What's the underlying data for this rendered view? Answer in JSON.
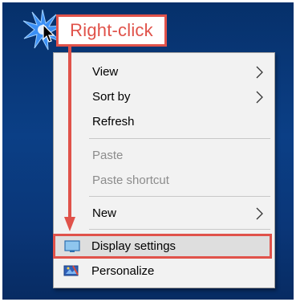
{
  "annotation": {
    "callout_text": "Right-click",
    "accent_color": "#e0524a"
  },
  "context_menu": {
    "items": [
      {
        "label": "View",
        "has_submenu": true,
        "disabled": false
      },
      {
        "label": "Sort by",
        "has_submenu": true,
        "disabled": false
      },
      {
        "label": "Refresh",
        "has_submenu": false,
        "disabled": false
      },
      {
        "label": "Paste",
        "has_submenu": false,
        "disabled": true
      },
      {
        "label": "Paste shortcut",
        "has_submenu": false,
        "disabled": true
      },
      {
        "label": "New",
        "has_submenu": true,
        "disabled": false
      },
      {
        "label": "Display settings",
        "has_submenu": false,
        "disabled": false,
        "icon": "display-icon",
        "highlighted": true
      },
      {
        "label": "Personalize",
        "has_submenu": false,
        "disabled": false,
        "icon": "personalize-icon"
      }
    ]
  },
  "desktop": {
    "background_color": "#0b3f86"
  }
}
